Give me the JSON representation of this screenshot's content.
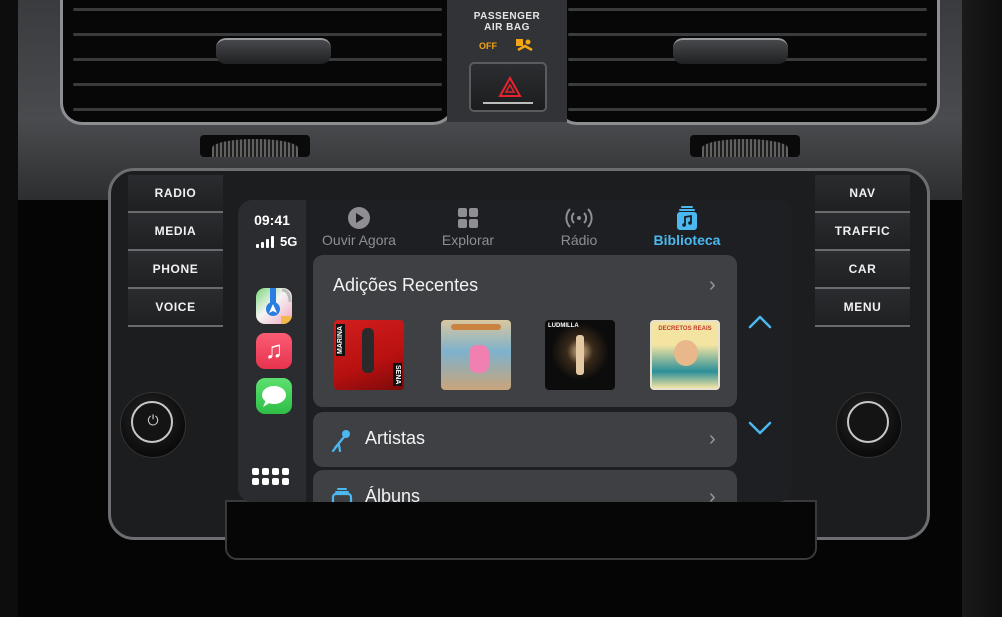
{
  "dashboard": {
    "airbag": {
      "line1": "PASSENGER",
      "line2": "AIR BAG",
      "status": "OFF"
    },
    "left_buttons": [
      "RADIO",
      "MEDIA",
      "PHONE",
      "VOICE"
    ],
    "right_buttons": [
      "NAV",
      "TRAFFIC",
      "CAR",
      "MENU"
    ],
    "power_glyph": "⏻"
  },
  "status": {
    "time": "09:41",
    "network": "5G",
    "signal_bars": 4
  },
  "dock": {
    "apps": [
      {
        "name": "Maps"
      },
      {
        "name": "Music",
        "glyph": "♫"
      },
      {
        "name": "Messages"
      }
    ]
  },
  "tabs": [
    {
      "label": "Ouvir Agora",
      "icon": "play-circle-icon",
      "active": false
    },
    {
      "label": "Explorar",
      "icon": "grid-icon",
      "active": false
    },
    {
      "label": "Rádio",
      "icon": "radio-waves-icon",
      "active": false
    },
    {
      "label": "Biblioteca",
      "icon": "library-music-icon",
      "active": true
    }
  ],
  "colors": {
    "accent": "#4cb8f0",
    "inactive": "#8e8e93",
    "card": "#3f4044",
    "screen": "#1e1f22",
    "hazard": "#e8232d",
    "airbag_warn": "#f2a516"
  },
  "library": {
    "recent_title": "Adições Recentes",
    "chevron": "›",
    "albums": [
      {
        "label_top": "MARINA",
        "label_bottom": "SENA"
      },
      {
        "label_top": ""
      },
      {
        "label_top": "LUDMILLA"
      },
      {
        "label_top": "DECRETOS REAIS"
      }
    ],
    "rows": [
      {
        "label": "Artistas",
        "icon": "microphone-icon"
      },
      {
        "label": "Álbuns",
        "icon": "album-stack-icon"
      }
    ]
  },
  "scroll": {
    "up": "scroll-up",
    "down": "scroll-down"
  }
}
